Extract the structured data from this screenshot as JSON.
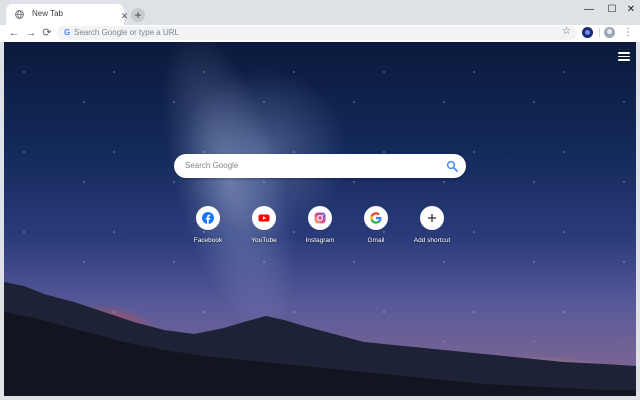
{
  "tab": {
    "title": "New Tab",
    "close_glyph": "✕"
  },
  "newtab": {
    "glyph": "+"
  },
  "window_controls": {
    "minimize": "—",
    "maximize": "☐",
    "close": "✕"
  },
  "toolbar": {
    "back": "←",
    "forward": "→",
    "reload": "⟳",
    "omnibox_placeholder": "Search Google or type a URL",
    "bookmark": "☆",
    "menu": "⋮"
  },
  "search": {
    "placeholder": "Search Google"
  },
  "shortcuts": [
    {
      "label": "Facebook",
      "icon": "facebook-icon",
      "color": "#1877f2"
    },
    {
      "label": "YouTube",
      "icon": "youtube-icon",
      "color": "#ff0000"
    },
    {
      "label": "Instagram",
      "icon": "instagram-icon",
      "color": "#c13584"
    },
    {
      "label": "Gmail",
      "icon": "google-icon",
      "color": "#4285f4"
    },
    {
      "label": "Add shortcut",
      "icon": "plus-icon",
      "color": "#5f6368"
    }
  ]
}
